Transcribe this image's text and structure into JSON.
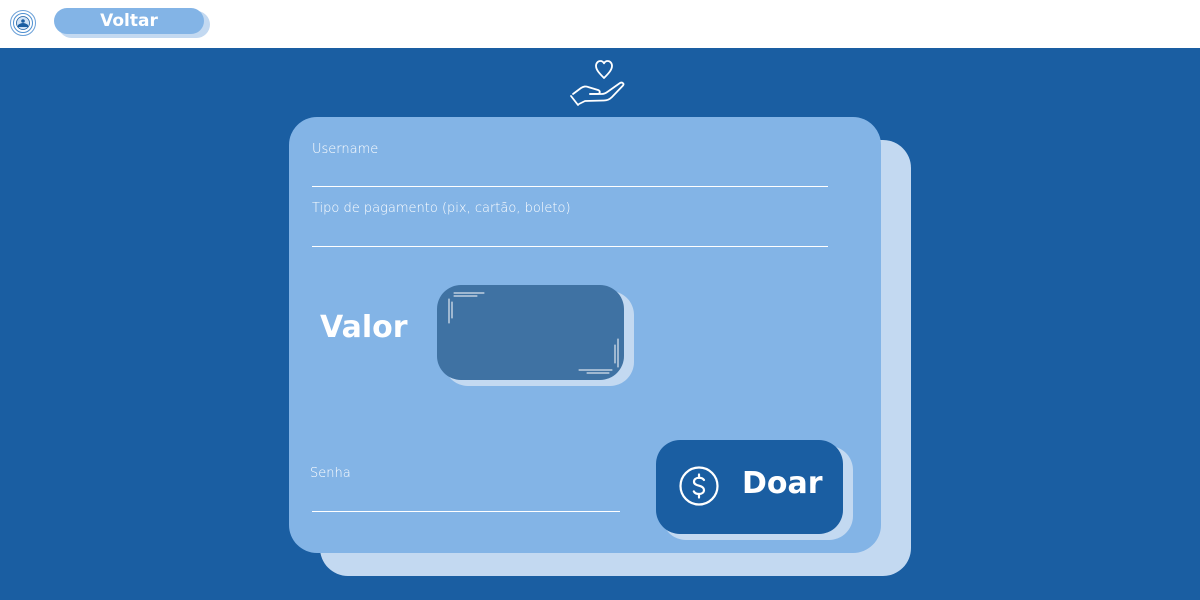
{
  "topbar": {
    "logo_icon": "seal-logo-icon",
    "back_label": "Voltar"
  },
  "form": {
    "username_label": "Username",
    "payment_label": "Tipo de pagamento (pix, cartão, boleto)",
    "valor_label": "Valor",
    "senha_label": "Senha",
    "donate_label": "Doar",
    "donate_icon": "dollar-circle-icon",
    "header_icon": "hand-heart-icon"
  },
  "colors": {
    "background": "#1a5ea2",
    "card": "#83b4e6",
    "card_shadow": "#c3d9f1",
    "valor_box": "#3f72a3",
    "button": "#1a5ea2"
  }
}
